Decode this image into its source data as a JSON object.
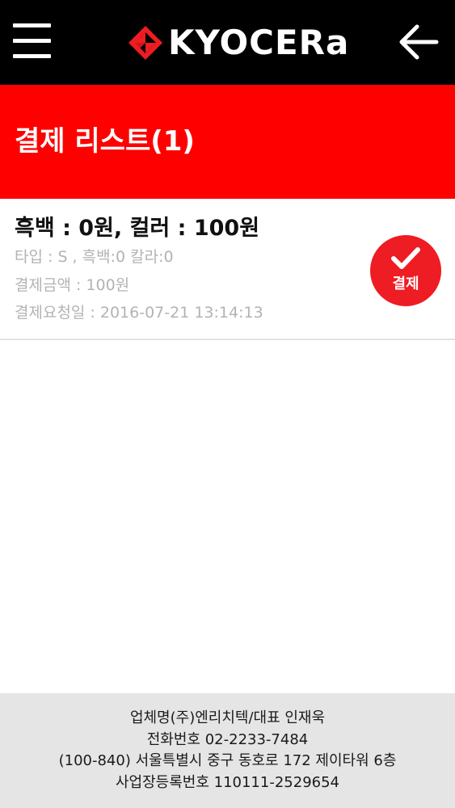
{
  "header": {
    "brand": "KYOCERa",
    "menu_icon": "hamburger-menu-icon",
    "back_icon": "arrow-left-icon",
    "logo_icon": "kyocera-logo-mark",
    "background_color": "#000000"
  },
  "title_bar": {
    "title": "결제 리스트(1)",
    "background_color": "#ff0000"
  },
  "payments": [
    {
      "heading": "흑백 : 0원, 컬러 : 100원",
      "type_line": "타입 : S , 흑백:0 칼라:0",
      "amount_line": "결제금액 : 100원",
      "requested_line": "결제요청일 : 2016-07-21 13:14:13",
      "pay_button": {
        "label": "결제",
        "icon": "check-icon",
        "color": "#ee1c23"
      }
    }
  ],
  "footer": {
    "company": "업체명(주)엔리치텍/대표 인재욱",
    "phone": "전화번호 02-2233-7484",
    "address": "(100-840) 서울특별시 중구 동호로 172 제이타워 6층",
    "business_number": "사업장등록번호 110111-2529654",
    "background_color": "#e5e5e5"
  }
}
